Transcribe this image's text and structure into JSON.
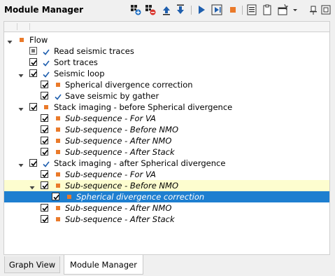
{
  "panel": {
    "title": "Module Manager",
    "toolbar": [
      {
        "name": "add-module-icon"
      },
      {
        "name": "remove-module-icon"
      },
      {
        "name": "move-up-icon"
      },
      {
        "name": "move-down-icon"
      },
      {
        "name": "run-icon"
      },
      {
        "name": "run-step-icon"
      },
      {
        "name": "stop-icon"
      },
      {
        "name": "list-icon"
      },
      {
        "name": "clipboard-icon"
      },
      {
        "name": "window-options-icon"
      },
      {
        "name": "dropdown-icon"
      },
      {
        "name": "pin-icon"
      },
      {
        "name": "float-icon"
      }
    ]
  },
  "tree": {
    "items": [
      {
        "label": "Flow",
        "level": 0,
        "expander": "expanded",
        "checkbox": "none",
        "icon": "square",
        "italic": false
      },
      {
        "label": "Read seismic traces",
        "level": 1,
        "expander": "none",
        "checkbox": "partial",
        "icon": "v",
        "italic": false
      },
      {
        "label": "Sort traces",
        "level": 1,
        "expander": "none",
        "checkbox": "checked",
        "icon": "v",
        "italic": false
      },
      {
        "label": "Seismic loop",
        "level": 1,
        "expander": "expanded",
        "checkbox": "checked",
        "icon": "v",
        "italic": false
      },
      {
        "label": "Spherical divergence correction",
        "level": 2,
        "expander": "none",
        "checkbox": "checked",
        "icon": "square",
        "italic": false
      },
      {
        "label": "Save seismic by gather",
        "level": 2,
        "expander": "none",
        "checkbox": "checked",
        "icon": "v",
        "italic": false
      },
      {
        "label": "Stack imaging - before Spherical divergence",
        "level": 1,
        "expander": "expanded",
        "checkbox": "checked",
        "icon": "square",
        "italic": false
      },
      {
        "label": "Sub-sequence - For VA",
        "level": 2,
        "expander": "none",
        "checkbox": "checked",
        "icon": "square",
        "italic": true
      },
      {
        "label": "Sub-sequence - Before NMO",
        "level": 2,
        "expander": "none",
        "checkbox": "checked",
        "icon": "square",
        "italic": true
      },
      {
        "label": "Sub-sequence - After NMO",
        "level": 2,
        "expander": "none",
        "checkbox": "checked",
        "icon": "square",
        "italic": true
      },
      {
        "label": "Sub-sequence - After Stack",
        "level": 2,
        "expander": "none",
        "checkbox": "checked",
        "icon": "square",
        "italic": true
      },
      {
        "label": "Stack imaging - after Spherical divergence",
        "level": 1,
        "expander": "expanded",
        "checkbox": "checked",
        "icon": "v",
        "italic": false
      },
      {
        "label": "Sub-sequence - For VA",
        "level": 2,
        "expander": "none",
        "checkbox": "checked",
        "icon": "square",
        "italic": true
      },
      {
        "label": "Sub-sequence - Before NMO",
        "level": 2,
        "expander": "expanded",
        "checkbox": "checked",
        "icon": "square",
        "italic": true,
        "highlight": "yellow"
      },
      {
        "label": "Spherical divergence correction",
        "level": 3,
        "expander": "none",
        "checkbox": "checked",
        "icon": "square",
        "italic": true,
        "highlight": "blue"
      },
      {
        "label": "Sub-sequence - After NMO",
        "level": 2,
        "expander": "none",
        "checkbox": "checked",
        "icon": "square",
        "italic": true
      },
      {
        "label": "Sub-sequence - After Stack",
        "level": 2,
        "expander": "none",
        "checkbox": "checked",
        "icon": "square",
        "italic": true
      }
    ]
  },
  "tabs": [
    {
      "label": "Graph View",
      "active": false
    },
    {
      "label": "Module Manager",
      "active": true
    }
  ],
  "colors": {
    "selection_blue": "#1e7fd0",
    "hover_yellow": "#fdfdcf",
    "module_orange": "#ea7a2a",
    "check_blue": "#1f5fae"
  }
}
